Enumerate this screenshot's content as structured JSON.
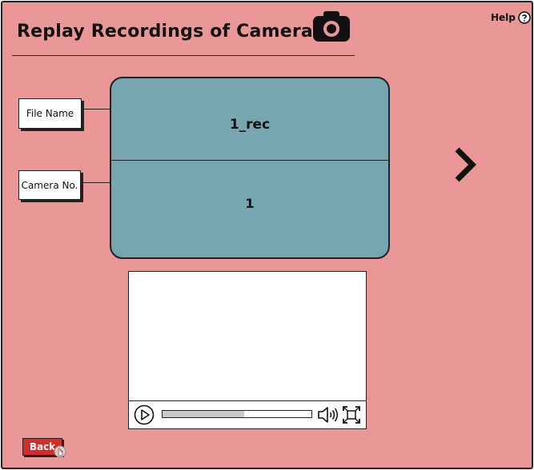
{
  "header": {
    "title": "Replay Recordings of Cameras",
    "camera_icon": "camera-icon",
    "help_label": "Help",
    "help_icon": "question-circle-icon"
  },
  "details": {
    "file_name_label": "File Name",
    "camera_no_label": "Camera No.",
    "file_name_value": "1_rec",
    "camera_no_value": "1"
  },
  "navigation": {
    "next_icon": "chevron-right-icon"
  },
  "player": {
    "play_icon": "play-circle-icon",
    "progress": 0.55,
    "volume_icon": "volume-icon",
    "fullscreen_icon": "fullscreen-icon"
  },
  "footer": {
    "back_label": "Back"
  },
  "colors": {
    "background": "#e99797",
    "card": "#77a6b1",
    "back_button": "#d62b2b"
  }
}
